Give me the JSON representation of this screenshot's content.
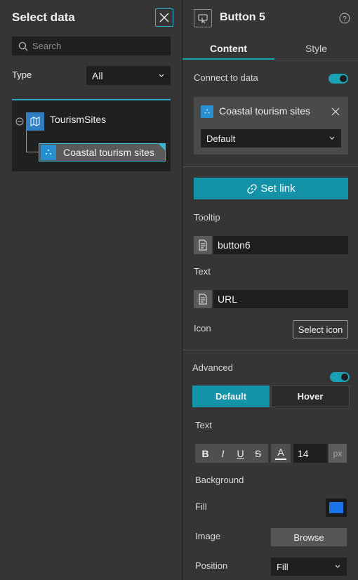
{
  "left_panel": {
    "title": "Select data",
    "search_placeholder": "Search",
    "type_label": "Type",
    "type_value": "All",
    "tree": {
      "map_name": "TourismSites",
      "layer_name": "Coastal tourism sites"
    }
  },
  "right_panel": {
    "title": "Button 5",
    "tabs": [
      "Content",
      "Style"
    ],
    "connect_to_data": {
      "label": "Connect to data",
      "enabled": true,
      "source_name": "Coastal tourism sites",
      "view": "Default"
    },
    "set_link_label": "Set link",
    "tooltip": {
      "label": "Tooltip",
      "value": "button6"
    },
    "text": {
      "label": "Text",
      "value": "URL"
    },
    "icon": {
      "label": "Icon",
      "button": "Select icon"
    },
    "advanced": {
      "label": "Advanced",
      "enabled": true,
      "states": [
        "Default",
        "Hover"
      ],
      "text_label": "Text",
      "format_buttons": [
        "B",
        "I",
        "U",
        "S",
        "A"
      ],
      "font_size": "14",
      "unit": "px",
      "background_label": "Background",
      "fill_label": "Fill",
      "fill_color": "#1a73e8",
      "image_label": "Image",
      "browse_label": "Browse",
      "position_label": "Position",
      "position_value": "Fill"
    }
  },
  "colors": {
    "accent": "#1493a8",
    "highlight": "#35b7d6",
    "panel_bg": "#353535"
  }
}
